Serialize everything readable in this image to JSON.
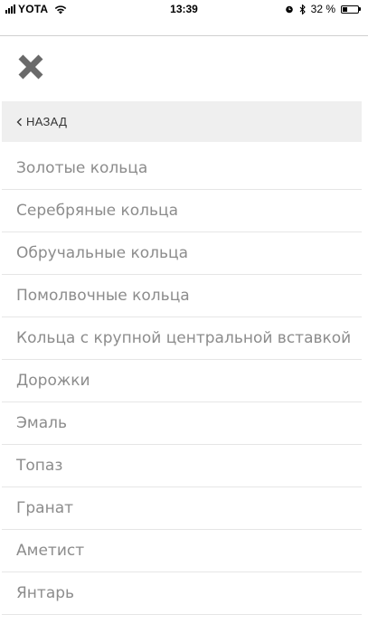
{
  "status_bar": {
    "carrier": "YOTA",
    "time": "13:39",
    "battery_percent": "32 %",
    "battery_level": 0.32,
    "icons": [
      "signal-icon",
      "wifi-icon",
      "alarm-icon",
      "bluetooth-icon",
      "battery-icon"
    ]
  },
  "nav": {
    "close_icon": "close-icon",
    "back_label": "НАЗАД",
    "back_icon": "chevron-left-icon"
  },
  "menu": {
    "items": [
      "Золотые кольца",
      "Серебряные кольца",
      "Обручальные кольца",
      "Помолвочные кольца",
      "Кольца с крупной центральной вставкой",
      "Дорожки",
      "Эмаль",
      "Топаз",
      "Гранат",
      "Аметист",
      "Янтарь"
    ]
  },
  "colors": {
    "item_text": "#8c8c8c",
    "back_bar_bg": "#efefef",
    "close_icon": "#6a6a6a",
    "divider": "#e6e6e6"
  }
}
